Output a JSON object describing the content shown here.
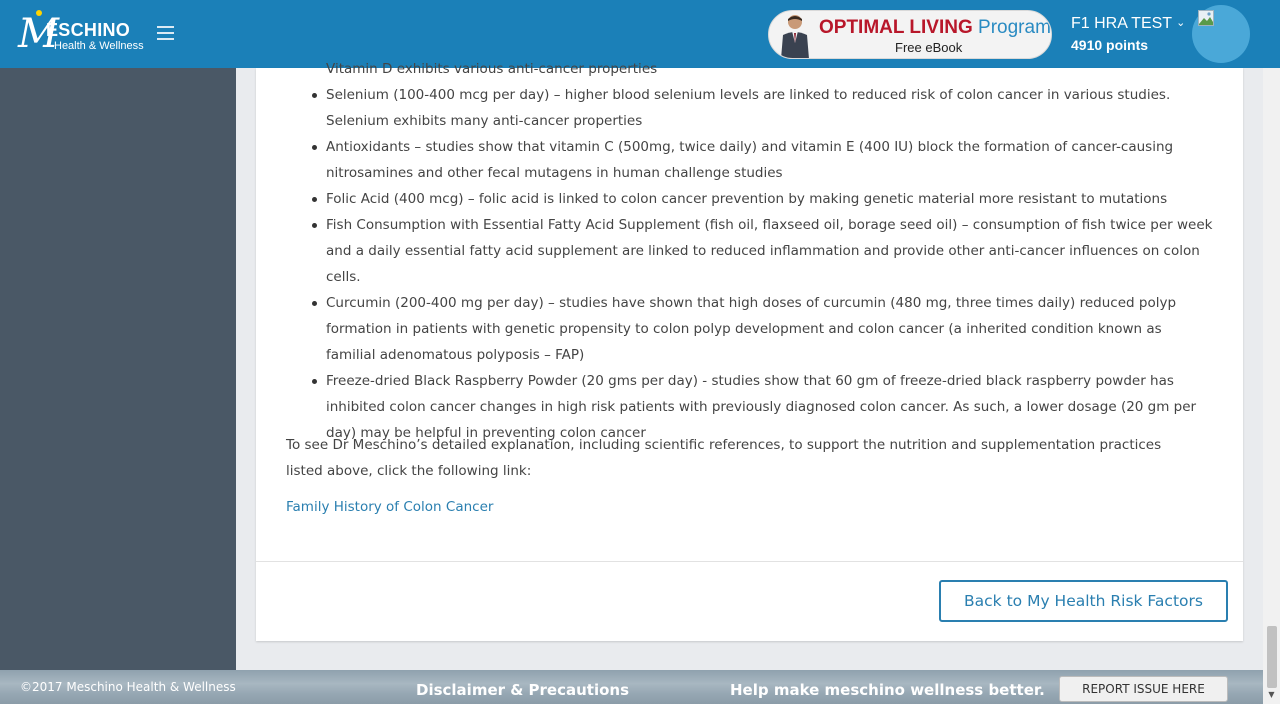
{
  "header": {
    "logo_mark": "M",
    "logo_word": "ESCHINO",
    "logo_sub": "Health & Wellness",
    "promo": {
      "title_a": "OPTIMAL LIVING",
      "title_b": "Program",
      "subtitle": "Free eBook"
    },
    "user": {
      "name": "F1 HRA TEST",
      "chevron": "⌄",
      "points": "4910 points"
    }
  },
  "content": {
    "partial_line": "Vitamin D exhibits various anti-cancer properties",
    "bullets": [
      "Selenium (100-400 mcg per day) – higher blood selenium levels are linked to reduced risk of colon cancer in various studies. Selenium exhibits many anti-cancer properties",
      "Antioxidants – studies show that vitamin C (500mg, twice daily) and vitamin E (400 IU) block the formation of cancer-causing nitrosamines and other fecal mutagens in human challenge studies",
      "Folic Acid (400 mcg) – folic acid is linked to colon cancer prevention by making genetic material more resistant to mutations",
      "Fish Consumption with Essential Fatty Acid Supplement (fish oil, flaxseed oil, borage seed oil) – consumption of fish twice per week and a daily essential fatty acid supplement are linked to reduced inflammation and provide other anti-cancer influences on colon cells.",
      "Curcumin (200-400 mg per day) – studies have shown that high doses of curcumin (480 mg, three times daily) reduced polyp formation in patients with genetic propensity to colon polyp development and colon cancer (a inherited condition known as familial adenomatous polyposis – FAP)",
      "Freeze-dried Black Raspberry Powder (20 gms per day) - studies show that 60 gm of freeze-dried black raspberry powder has inhibited colon cancer changes in high risk patients with previously diagnosed colon cancer. As such, a lower dosage (20 gm per day) may be helpful in preventing colon cancer"
    ],
    "paragraph": "To see Dr Meschino’s detailed explanation, including scientific references, to support the nutrition and supplementation practices listed above, click the following link:",
    "link": "Family History of Colon Cancer",
    "back_button": "Back to My Health Risk Factors"
  },
  "footer": {
    "copyright": "©2017 Meschino Health & Wellness",
    "disclaimer": "Disclaimer & Precautions",
    "help": "Help make meschino wellness better.",
    "report_button": "REPORT ISSUE HERE"
  },
  "colors": {
    "header_bg": "#1b80b8",
    "sidebar_bg": "#4a5866",
    "link": "#2a7fb0",
    "promo_red": "#b8172a",
    "promo_blue": "#2a8bc2"
  }
}
